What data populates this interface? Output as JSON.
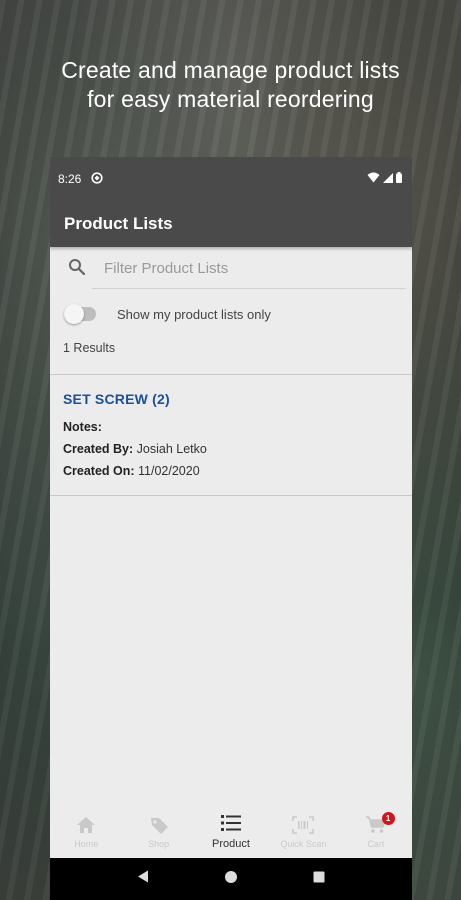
{
  "headline": {
    "line1": "Create and manage product lists",
    "line2": "for easy material reordering"
  },
  "statusbar": {
    "time": "8:26"
  },
  "appbar": {
    "title": "Product Lists"
  },
  "search": {
    "placeholder": "Filter Product Lists",
    "value": ""
  },
  "filter_toggle": {
    "label": "Show my product lists only",
    "on": false
  },
  "results_text": "1 Results",
  "product_lists": [
    {
      "title": "SET SCREW  (2)",
      "notes_label": "Notes:",
      "notes_value": "",
      "created_by_label": "Created By:",
      "created_by_value": "Josiah Letko",
      "created_on_label": "Created On:",
      "created_on_value": "11/02/2020"
    }
  ],
  "bottom_nav": {
    "items": [
      {
        "label": "Home",
        "icon": "home-icon"
      },
      {
        "label": "Shop",
        "icon": "tag-icon"
      },
      {
        "label": "Product",
        "icon": "list-icon"
      },
      {
        "label": "Quick Scan",
        "icon": "barcode-scan-icon"
      },
      {
        "label": "Cart",
        "icon": "cart-icon"
      }
    ],
    "active": "Product",
    "cart_badge": "1"
  },
  "colors": {
    "appbar": "#4a4a4a",
    "link_blue": "#1c4f9c",
    "badge_red": "#d0161b",
    "content_bg": "#ececec"
  }
}
